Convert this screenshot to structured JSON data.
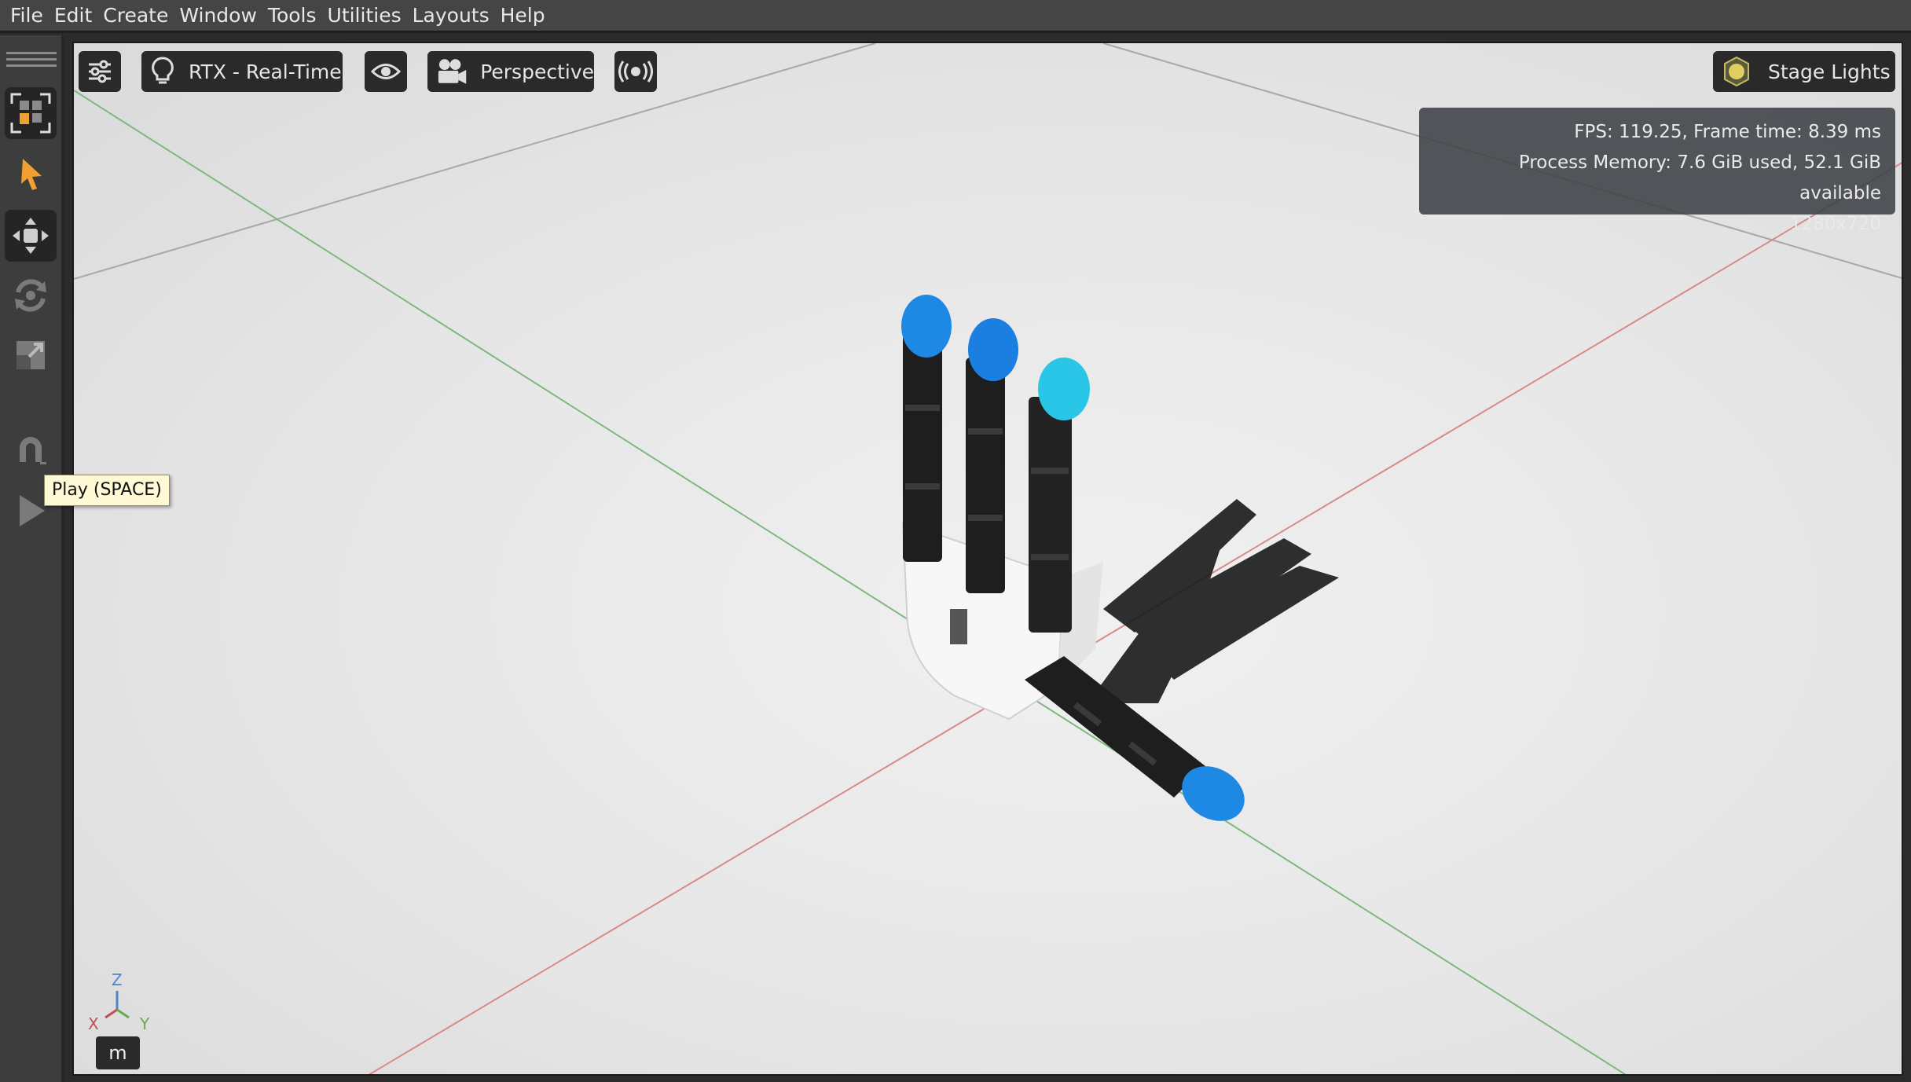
{
  "menubar": {
    "items": [
      "File",
      "Edit",
      "Create",
      "Window",
      "Tools",
      "Utilities",
      "Layouts",
      "Help"
    ]
  },
  "left_toolbar": {
    "tools": [
      "frame-selection-icon",
      "select-arrow-icon",
      "move-icon",
      "rotate-icon",
      "scale-icon",
      "snap-magnet-icon",
      "play-icon"
    ],
    "tooltip": "Play (SPACE)"
  },
  "viewport_toolbar": {
    "renderer": "RTX - Real-Time",
    "camera": "Perspective",
    "lights": "Stage Lights"
  },
  "stats": {
    "fps_line": "FPS: 119.25, Frame time: 8.39 ms",
    "memory_line": "Process Memory: 7.6 GiB used, 52.1 GiB available",
    "resolution": "1280x720"
  },
  "axis_gizmo": {
    "z": "Z",
    "x": "X",
    "y": "Y"
  },
  "unit_badge": "m",
  "colors": {
    "accent": "#f0a030",
    "x_axis": "#c0504d",
    "y_axis": "#6aa84f",
    "z_axis": "#4a86c8",
    "fingertip": "#1e88e5",
    "fingertip_highlight": "#29c6e8"
  }
}
